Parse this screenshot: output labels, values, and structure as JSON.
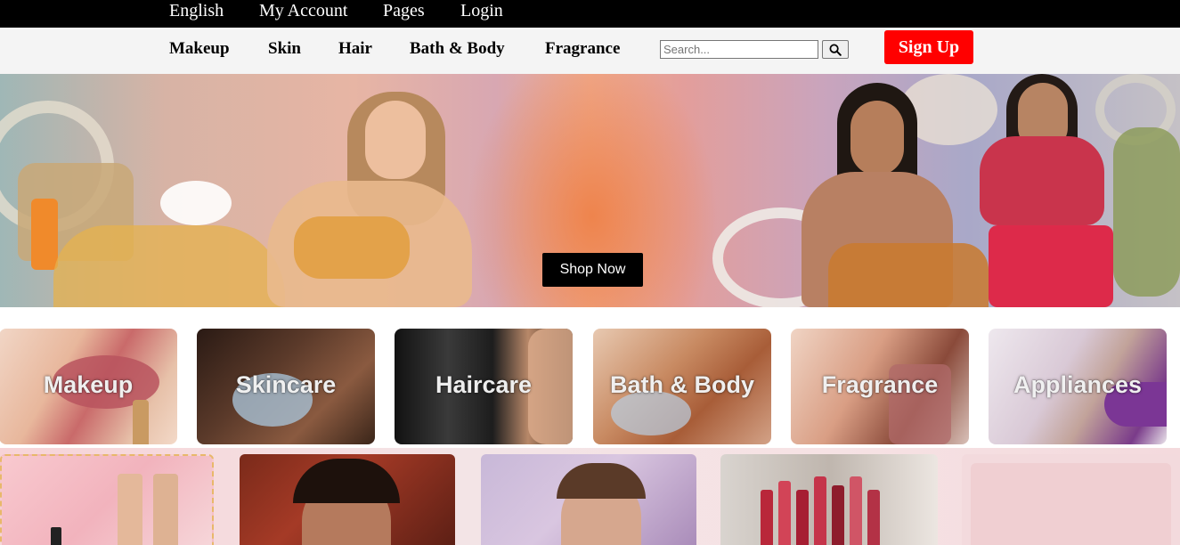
{
  "top_bar": {
    "links": [
      "English",
      "My Account",
      "Pages",
      "Login"
    ]
  },
  "nav": {
    "categories": [
      "Makeup",
      "Skin",
      "Hair",
      "Bath & Body",
      "Fragrance"
    ],
    "search": {
      "placeholder": "Search...",
      "value": "",
      "icon": "search-icon"
    },
    "signup_label": "Sign Up"
  },
  "hero": {
    "cta_label": "Shop Now"
  },
  "category_tiles": [
    {
      "label": "Makeup"
    },
    {
      "label": "Skincare"
    },
    {
      "label": "Haircare"
    },
    {
      "label": "Bath & Body"
    },
    {
      "label": "Fragrance"
    },
    {
      "label": "Appliances"
    }
  ],
  "colors": {
    "top_bar_bg": "#000000",
    "nav_bg": "#f4f4f4",
    "signup_bg": "#ff0000",
    "cta_bg": "#000000",
    "promo_bg": "#f6dfe2"
  }
}
